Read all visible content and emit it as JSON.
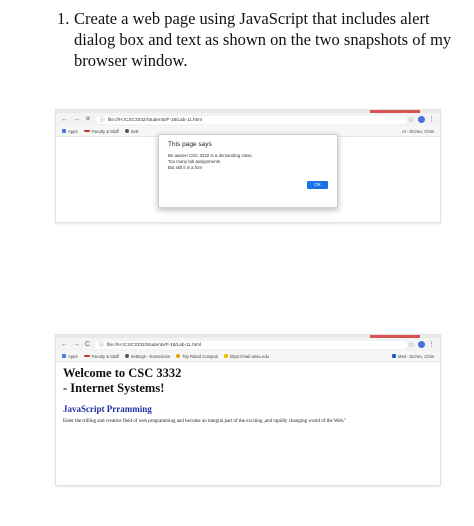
{
  "question": {
    "number": "1.",
    "lines": [
      "Create a web page using JavaScript that includes alert",
      "dialog box and text as shown on the two snapshots of my",
      "browser window."
    ]
  },
  "screenshot1": {
    "nav": {
      "back": "←",
      "forward": "→",
      "action": "✕"
    },
    "url": "file:///H:/CSC3332/Students/F-18/Lab-11.html",
    "bookmarks": {
      "apps": "Apps",
      "faculty": "Faculty & Staff",
      "settings": "Sett",
      "right": "el - Dichev, Chris"
    },
    "dialog": {
      "title": "This page says",
      "lines": [
        "Be aware! CSC 3332 is a demanding class.",
        "Too many lab assignments.",
        "But still it is a fun!"
      ],
      "ok_label": "OK"
    }
  },
  "screenshot2": {
    "nav": {
      "back": "←",
      "forward": "→",
      "action": "C"
    },
    "url": "file:///H:/CSC3332/Students/F-18/Lab-11.html",
    "bookmarks": {
      "apps": "Apps",
      "faculty": "Faculty & Staff",
      "settings": "Settings - Extensions",
      "top": "Top Rated Computi",
      "mail": "https://mail.wssu.edu",
      "right": "Mail - Dichev, Chris"
    },
    "page": {
      "heading_lines": [
        "Welcome to CSC 3332",
        "- Internet Systems!"
      ],
      "subheading": "JavaScript Prramming",
      "paragraph": "Enter the trilling and creative field of web programming and become an integral part of the exciting ,and rapidly changing world of the Web.\""
    }
  },
  "colors": {
    "accent": "#1a73e8",
    "subheading": "#1f2fa8"
  }
}
